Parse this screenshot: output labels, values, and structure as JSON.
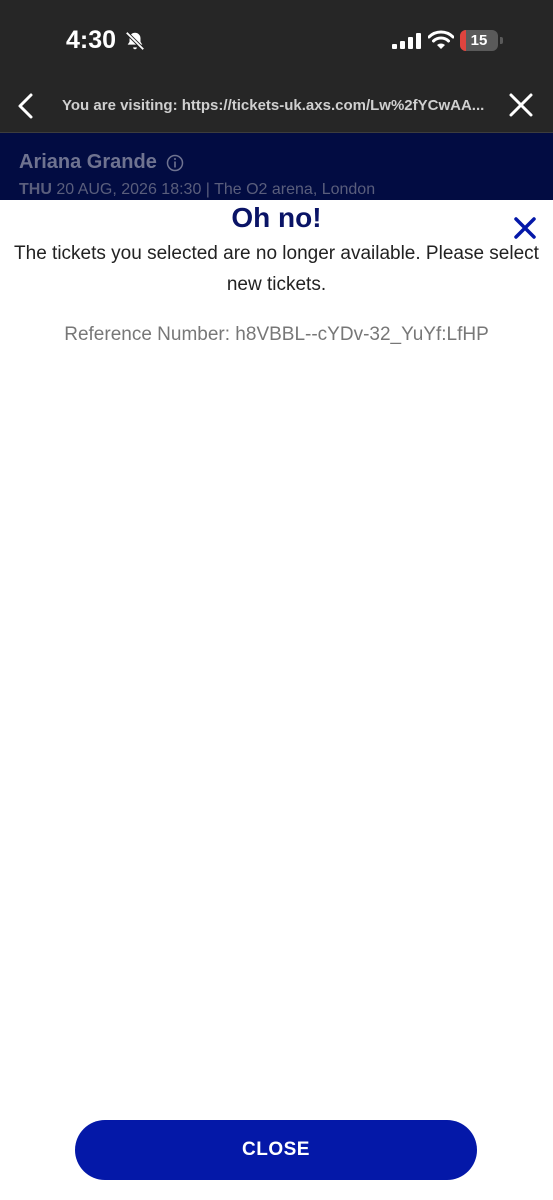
{
  "status_bar": {
    "time": "4:30",
    "battery_level": "15",
    "battery_percent": 15,
    "battery_color": "#e0443e",
    "icons": [
      "bell-slash-icon",
      "cellular-signal-icon",
      "wifi-icon",
      "battery-icon"
    ]
  },
  "browser": {
    "url_text": "You are visiting: https://tickets-uk.axs.com/Lw%2fYCwAA...",
    "icons": [
      "chevron-left-icon",
      "close-icon"
    ]
  },
  "event": {
    "title": "Ariana Grande",
    "day": "THU",
    "details": " 20 AUG, 2026 18:30 | The O2 arena, London",
    "icons": [
      "info-circle-icon"
    ]
  },
  "modal": {
    "title": "Oh no!",
    "message": "The tickets you selected are no longer available. Please select new tickets.",
    "reference": "Reference Number: h8VBBL--cYDv-32_YuYf:LfHP",
    "close_label": "CLOSE",
    "accent_color": "#0418a8",
    "title_color": "#0a1466",
    "icons": [
      "close-icon"
    ]
  }
}
